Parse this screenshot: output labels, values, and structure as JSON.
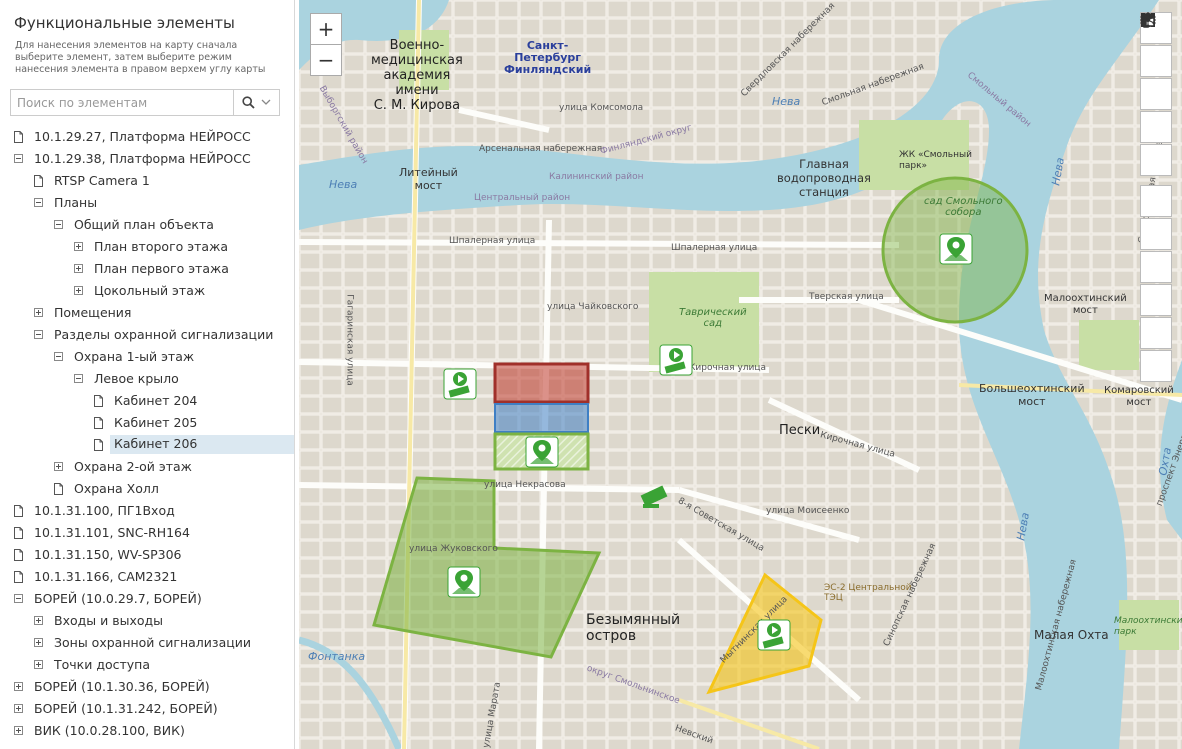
{
  "sidebar": {
    "title": "Функциональные элементы",
    "description": "Для нанесения элементов на карту сначала выберите элемент, затем выберите режим нанесения элемента в правом верхем углу карты",
    "search_placeholder": "Поиск по элементам",
    "tree": [
      {
        "label": "10.1.29.27, Платформа НЕЙРОСС",
        "level": 0,
        "type": "doc"
      },
      {
        "label": "10.1.29.38, Платформа НЕЙРОСС",
        "level": 0,
        "type": "expanded"
      },
      {
        "label": "RTSP Camera 1",
        "level": 1,
        "type": "doc"
      },
      {
        "label": "Планы",
        "level": 1,
        "type": "expanded"
      },
      {
        "label": "Общий план объекта",
        "level": 2,
        "type": "expanded"
      },
      {
        "label": "План второго этажа",
        "level": 3,
        "type": "collapsed"
      },
      {
        "label": "План первого этажа",
        "level": 3,
        "type": "collapsed"
      },
      {
        "label": "Цокольный этаж",
        "level": 3,
        "type": "collapsed"
      },
      {
        "label": "Помещения",
        "level": 1,
        "type": "collapsed"
      },
      {
        "label": "Разделы охранной сигнализации",
        "level": 1,
        "type": "expanded"
      },
      {
        "label": "Охрана 1-ый этаж",
        "level": 2,
        "type": "expanded"
      },
      {
        "label": "Левое крыло",
        "level": 3,
        "type": "expanded"
      },
      {
        "label": "Кабинет 204",
        "level": 4,
        "type": "doc"
      },
      {
        "label": "Кабинет 205",
        "level": 4,
        "type": "doc"
      },
      {
        "label": "Кабинет 206",
        "level": 4,
        "type": "doc",
        "selected": true
      },
      {
        "label": "Охрана 2-ой этаж",
        "level": 2,
        "type": "collapsed"
      },
      {
        "label": "Охрана Холл",
        "level": 2,
        "type": "doc"
      },
      {
        "label": "10.1.31.100, ПГ1Вход",
        "level": 0,
        "type": "doc"
      },
      {
        "label": "10.1.31.101, SNC-RH164",
        "level": 0,
        "type": "doc"
      },
      {
        "label": "10.1.31.150, WV-SP306",
        "level": 0,
        "type": "doc"
      },
      {
        "label": "10.1.31.166, CAM2321",
        "level": 0,
        "type": "doc"
      },
      {
        "label": "БОРЕЙ (10.0.29.7, БОРЕЙ)",
        "level": 0,
        "type": "expanded"
      },
      {
        "label": "Входы и выходы",
        "level": 1,
        "type": "collapsed"
      },
      {
        "label": "Зоны охранной сигнализации",
        "level": 1,
        "type": "collapsed"
      },
      {
        "label": "Точки доступа",
        "level": 1,
        "type": "collapsed"
      },
      {
        "label": "БОРЕЙ (10.1.30.36, БОРЕЙ)",
        "level": 0,
        "type": "collapsed"
      },
      {
        "label": "БОРЕЙ (10.1.31.242, БОРЕЙ)",
        "level": 0,
        "type": "collapsed"
      },
      {
        "label": "ВИК (10.0.28.100, ВИК)",
        "level": 0,
        "type": "collapsed"
      }
    ]
  },
  "map": {
    "zoom_in": "+",
    "zoom_out": "−",
    "tools": [
      "marker-icon",
      "polyline-icon",
      "rectangle-icon",
      "polygon-icon",
      "circle-icon",
      "edit-cursor-icon",
      "move-icon",
      "eraser-icon",
      "rotate-icon",
      "duplicate-icon",
      "network-icon"
    ],
    "labels": {
      "spb_station": "Санкт-\nПетербург\nФинляндский",
      "academy": "Военно-\nмедицинская\nакадемия\nимени\nС. М. Кирова",
      "nevka": "Нева",
      "nevka2": "Нева",
      "nevka3": "Нева",
      "neva_right": "Нева",
      "okhta": "Охта",
      "liteyny": "Литейный\nмост",
      "vodoprovod": "Главная\nводопроводная\nстанция",
      "smolny_park": "ЖК «Смольный\nпарк»",
      "smolny_sobor": "сад Смольного\nсобора",
      "tavrich": "Таврический\nсад",
      "peski": "Пески",
      "bolsheokht": "Большеохтинский\nмост",
      "maloohtinsky": "Малоохтинский\nмост",
      "komarovsky": "Комаровский\nмост",
      "bezymyanny": "Безымянный\nостров",
      "malaya_okhta": "Малая Охта",
      "maloohta_park": "Малоохтинский\nпарк",
      "fontanka": "Фонтанка",
      "tec": "ЭС-2 Центральной\nТЭЦ",
      "shpalernaya1": "Шпалерная улица",
      "shpalernaya2": "Шпалерная улица",
      "chaikovskogo": "улица Чайковского",
      "tverskaya": "Тверская улица",
      "kirochnaya": "Кирочная улица",
      "kirochnaya2": "Кирочная улица",
      "nekrasova": "улица Некрасова",
      "moiseenko": "улица Моисеенко",
      "zhukovskogo": "улица Жуковского",
      "sovetskaya": "8-я Советская улица",
      "mytninskaya": "Мытнинская улица",
      "arsenal": "Арсенальная набережная",
      "kalininsky": "Калининский район",
      "central": "Центральный район",
      "vyborg": "Выборгский район",
      "finlandsky": "Финляндский округ",
      "komsomola": "улица Комсомола",
      "smolnaya_nab": "Смольная набережная",
      "sverdl_nab": "Свердловская набережная",
      "sverdl_nab2": "Свердловская набережная",
      "smolny_rayon": "Смольный район",
      "gagarinskaya": "Гагаринская улица",
      "sinopskaya": "Синопская набережная",
      "smolninskoe": "округ Смольнинское",
      "marata": "улица Марата",
      "nevsky": "Невский",
      "maloohta_nab": "Малоохтинская набережная",
      "pr_energ": "проспект Энергетиков"
    }
  },
  "colors": {
    "park": "#c8dfa5",
    "water": "#aad3df",
    "alarm_red": "#c0392b",
    "alarm_blue": "#3f7fc4",
    "zone_green": "#7cb342",
    "zone_yellow": "#f5c518",
    "marker_green": "#3aa335"
  }
}
